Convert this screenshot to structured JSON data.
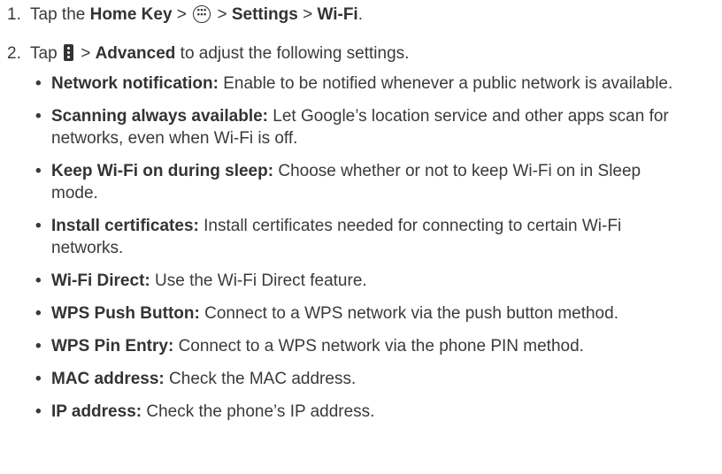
{
  "steps": [
    {
      "number": "1.",
      "text_prefix": "Tap the ",
      "home_key": "Home Key",
      "sep1": " > ",
      "sep2": " > ",
      "settings": "Settings",
      "sep3": " > ",
      "wifi": "Wi-Fi",
      "end": "."
    },
    {
      "number": "2.",
      "text_prefix": "Tap ",
      "sep1": " > ",
      "advanced": "Advanced",
      "suffix": " to adjust the following settings."
    }
  ],
  "icons": {
    "apps": "apps-icon",
    "menu": "menu-icon"
  },
  "settings_list": [
    {
      "term": "Network notification:",
      "desc": " Enable to be notified whenever a public network is available."
    },
    {
      "term": "Scanning always available:",
      "desc": " Let Google’s location service and other apps scan for networks, even when Wi-Fi is off."
    },
    {
      "term": "Keep Wi-Fi on during sleep:",
      "desc": " Choose whether or not to keep Wi-Fi on in Sleep mode."
    },
    {
      "term": "Install certificates:",
      "desc": " Install certificates needed for connecting to certain Wi-Fi networks."
    },
    {
      "term": "Wi-Fi Direct:",
      "desc": " Use the Wi-Fi Direct feature."
    },
    {
      "term": "WPS Push Button:",
      "desc": " Connect to a WPS network via the push button method."
    },
    {
      "term": "WPS Pin Entry:",
      "desc": " Connect to a WPS network via the phone PIN method."
    },
    {
      "term": "MAC address:",
      "desc": " Check the MAC address."
    },
    {
      "term": "IP address:",
      "desc": " Check the phone’s IP address."
    }
  ],
  "bullet": "•"
}
